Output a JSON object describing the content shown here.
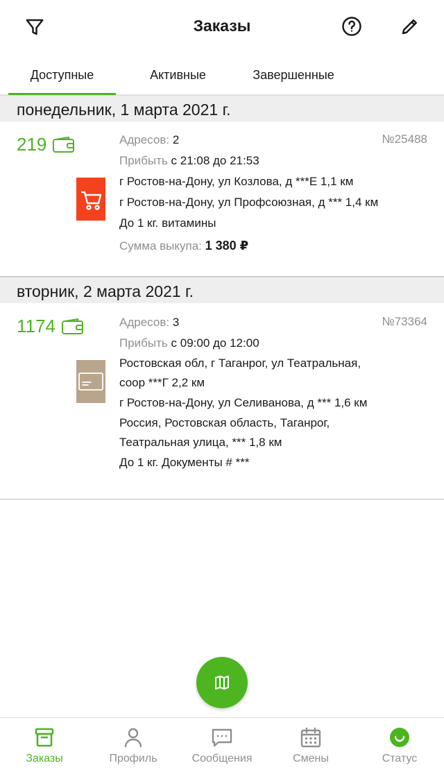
{
  "header": {
    "title": "Заказы",
    "filter_icon": "filter-icon",
    "help_icon": "help-icon",
    "edit_icon": "edit-icon"
  },
  "tabs": [
    {
      "label": "Доступные",
      "active": true
    },
    {
      "label": "Активные",
      "active": false
    },
    {
      "label": "Завершенные",
      "active": false
    }
  ],
  "days": [
    {
      "date": "понедельник, 1 марта 2021 г.",
      "order": {
        "price": "219",
        "addresses_label": "Адресов:",
        "addresses_count": "2",
        "number": "№25488",
        "arrive_label": "Прибыть",
        "arrive_time": "с 21:08 до 21:53",
        "icon": "shopping-cart-icon",
        "lines": [
          "г Ростов-на-Дону, ул Козлова, д ***Е 1,1 км",
          "г Ростов-на-Дону, ул Профсоюзная, д *** 1,4 км",
          "До 1 кг. витамины"
        ],
        "sum_label": "Сумма выкупа:",
        "sum_value": "1 380 ₽"
      }
    },
    {
      "date": "вторник, 2 марта 2021 г.",
      "order": {
        "price": "1174",
        "addresses_label": "Адресов:",
        "addresses_count": "3",
        "number": "№73364",
        "arrive_label": "Прибыть",
        "arrive_time": "с 09:00 до 12:00",
        "icon": "document-card-icon",
        "lines": [
          "Ростовская обл, г Таганрог, ул Театральная,",
          "соор ***Г 2,2 км",
          "г Ростов-на-Дону, ул Селиванова, д *** 1,6 км",
          "Россия, Ростовская область, Таганрог,",
          "Театральная улица, *** 1,8 км",
          "До 1 кг. Документы # ***"
        ]
      }
    }
  ],
  "fab": {
    "icon": "map-icon"
  },
  "bottom_nav": [
    {
      "label": "Заказы",
      "icon": "orders-box-icon",
      "active": true
    },
    {
      "label": "Профиль",
      "icon": "profile-icon",
      "active": false
    },
    {
      "label": "Сообщения",
      "icon": "messages-icon",
      "active": false
    },
    {
      "label": "Смены",
      "icon": "calendar-icon",
      "active": false
    },
    {
      "label": "Статус",
      "icon": "status-smile-icon",
      "active": false
    }
  ],
  "colors": {
    "accent": "#4cb520",
    "muted_text": "#8f8f8f",
    "day_header_bg": "#eeeeee",
    "cart_icon_bg": "#f4411e",
    "doc_icon_bg": "#b8a58c"
  }
}
